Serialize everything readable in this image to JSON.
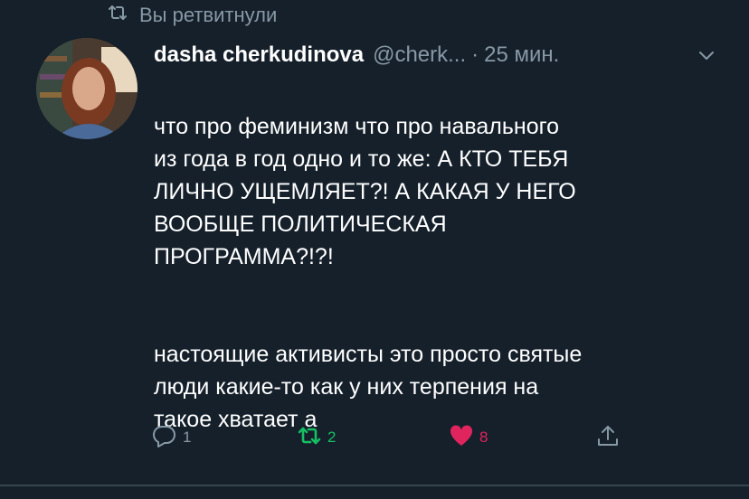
{
  "retweet_context": {
    "text": "Вы ретвитнули"
  },
  "tweet": {
    "author": {
      "display_name": "dasha cherkudinova",
      "handle": "@cherk...",
      "separator": "·",
      "time": "25 мин."
    },
    "text_paragraph_1": "что про феминизм что про навального\nиз года в год одно и то же: А КТО ТЕБЯ\nЛИЧНО УЩЕМЛЯЕТ?! А КАКАЯ У НЕГО\nВООБЩЕ ПОЛИТИЧЕСКАЯ\nПРОГРАММА?!?!",
    "text_paragraph_2": "настоящие активисты это просто святые\nлюди какие-то как у них терпения на\nтакое хватает а",
    "actions": {
      "reply_count": "1",
      "retweet_count": "2",
      "like_count": "8"
    }
  },
  "icons": {
    "retweet_context": "retweet-icon",
    "reply": "reply-icon",
    "retweet": "retweet-icon",
    "like": "heart-icon",
    "share": "share-icon",
    "menu": "chevron-down-icon"
  },
  "colors": {
    "background": "#15202b",
    "secondary_text": "#8899a6",
    "retweet_active": "#17bf63",
    "like_active": "#e0245e",
    "divider": "#38444d"
  }
}
